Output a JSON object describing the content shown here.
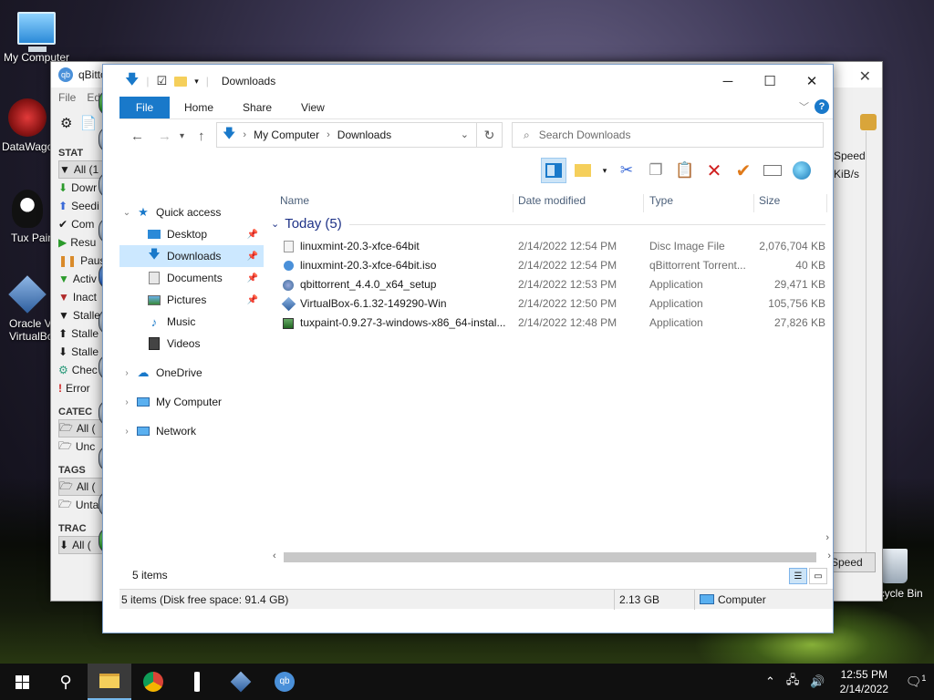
{
  "desktop": {
    "icons": [
      {
        "label": "My Computer"
      },
      {
        "label": "DataWago"
      },
      {
        "label": "Tux Pain"
      },
      {
        "label": "Oracle V"
      },
      {
        "label": "VirtualBo"
      },
      {
        "label": "Recycle Bin"
      }
    ]
  },
  "qbt": {
    "title": "qBittor",
    "menu": [
      "File",
      "Edi"
    ],
    "status_header": "STAT",
    "status_items": [
      "All (1",
      "Dowr",
      "Seedi",
      "Com",
      "Resu",
      "Paus",
      "Activ",
      "Inact",
      "Stalle",
      "Stalle",
      "Stalle",
      "Chec",
      "Error"
    ],
    "categories_header": "CATEC",
    "categories_items": [
      "All (",
      "Unc"
    ],
    "tags_header": "TAGS",
    "tags_items": [
      "All (",
      "Unta"
    ],
    "trackers_header": "TRAC",
    "trackers_items": [
      "All ("
    ],
    "right_col": [
      "Speed",
      "KiB/s"
    ],
    "speed_button": "Speed"
  },
  "explorer": {
    "title": "Downloads",
    "tabs": {
      "file": "File",
      "home": "Home",
      "share": "Share",
      "view": "View"
    },
    "address": {
      "root": "My Computer",
      "current": "Downloads"
    },
    "search_placeholder": "Search Downloads",
    "nav": {
      "quick_access": "Quick access",
      "desktop": "Desktop",
      "downloads": "Downloads",
      "documents": "Documents",
      "pictures": "Pictures",
      "music": "Music",
      "videos": "Videos",
      "onedrive": "OneDrive",
      "mycomputer": "My Computer",
      "network": "Network"
    },
    "columns": {
      "name": "Name",
      "date": "Date modified",
      "type": "Type",
      "size": "Size"
    },
    "group": "Today (5)",
    "files": [
      {
        "name": "linuxmint-20.3-xfce-64bit",
        "date": "2/14/2022 12:54 PM",
        "type": "Disc Image File",
        "size": "2,076,704 KB"
      },
      {
        "name": "linuxmint-20.3-xfce-64bit.iso",
        "date": "2/14/2022 12:54 PM",
        "type": "qBittorrent Torrent...",
        "size": "40 KB"
      },
      {
        "name": "qbittorrent_4.4.0_x64_setup",
        "date": "2/14/2022 12:53 PM",
        "type": "Application",
        "size": "29,471 KB"
      },
      {
        "name": "VirtualBox-6.1.32-149290-Win",
        "date": "2/14/2022 12:50 PM",
        "type": "Application",
        "size": "105,756 KB"
      },
      {
        "name": "tuxpaint-0.9.27-3-windows-x86_64-instal...",
        "date": "2/14/2022 12:48 PM",
        "type": "Application",
        "size": "27,826 KB"
      }
    ],
    "status_items": "5 items",
    "status_disk": "5 items (Disk free space: 91.4 GB)",
    "status_size": "2.13 GB",
    "status_location": "Computer"
  },
  "taskbar": {
    "time": "12:55 PM",
    "date": "2/14/2022",
    "notification_count": "1"
  }
}
